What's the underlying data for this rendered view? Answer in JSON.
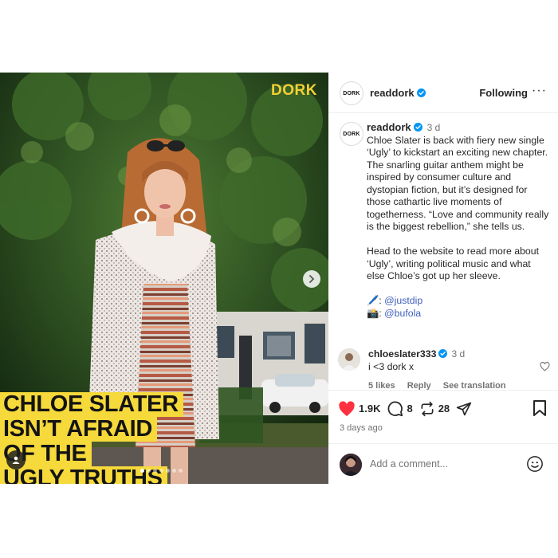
{
  "post": {
    "brand_logo": "DORK",
    "headline": [
      "CHLOE SLATER",
      "ISN’T AFRAID",
      "OF THE",
      "UGLY TRUTHS"
    ],
    "carousel_count": 7,
    "carousel_active": 1
  },
  "header": {
    "avatar_text": "DORK",
    "username": "readdork",
    "follow_label": "Following",
    "more": "···"
  },
  "caption": {
    "avatar_text": "DORK",
    "username": "readdork",
    "time": "3 d",
    "body": "Chloe Slater is back with fiery new single ‘Ugly’ to kickstart an exciting new chapter. The snarling guitar anthem might be inspired by consumer culture and dystopian fiction, but it’s designed for those cathartic live moments of togetherness. “Love and community really is the biggest rebellion,” she tells us.",
    "body2": "Head to the website to read more about ‘Ugly’, writing political music and what else Chloe’s got up her sleeve.",
    "credits": [
      {
        "prefix": "🖊️: ",
        "handle": "@justdip"
      },
      {
        "prefix": "📸: ",
        "handle": "@bufola"
      }
    ]
  },
  "comment": {
    "username": "chloeslater333",
    "time": "3 d",
    "text": "i <3 dork x",
    "likes": "5 likes",
    "reply": "Reply",
    "translate": "See translation"
  },
  "actions": {
    "likes": "1.9K",
    "comments": "8",
    "reposts": "28",
    "ago": "3 days ago",
    "add_placeholder": "Add a comment..."
  },
  "colors": {
    "headline_bg": "#f6d93a",
    "brand_logo": "#f4d033",
    "like_red": "#ff3040",
    "verified_blue": "#0095f6",
    "handle_blue": "#3d5ebd"
  }
}
